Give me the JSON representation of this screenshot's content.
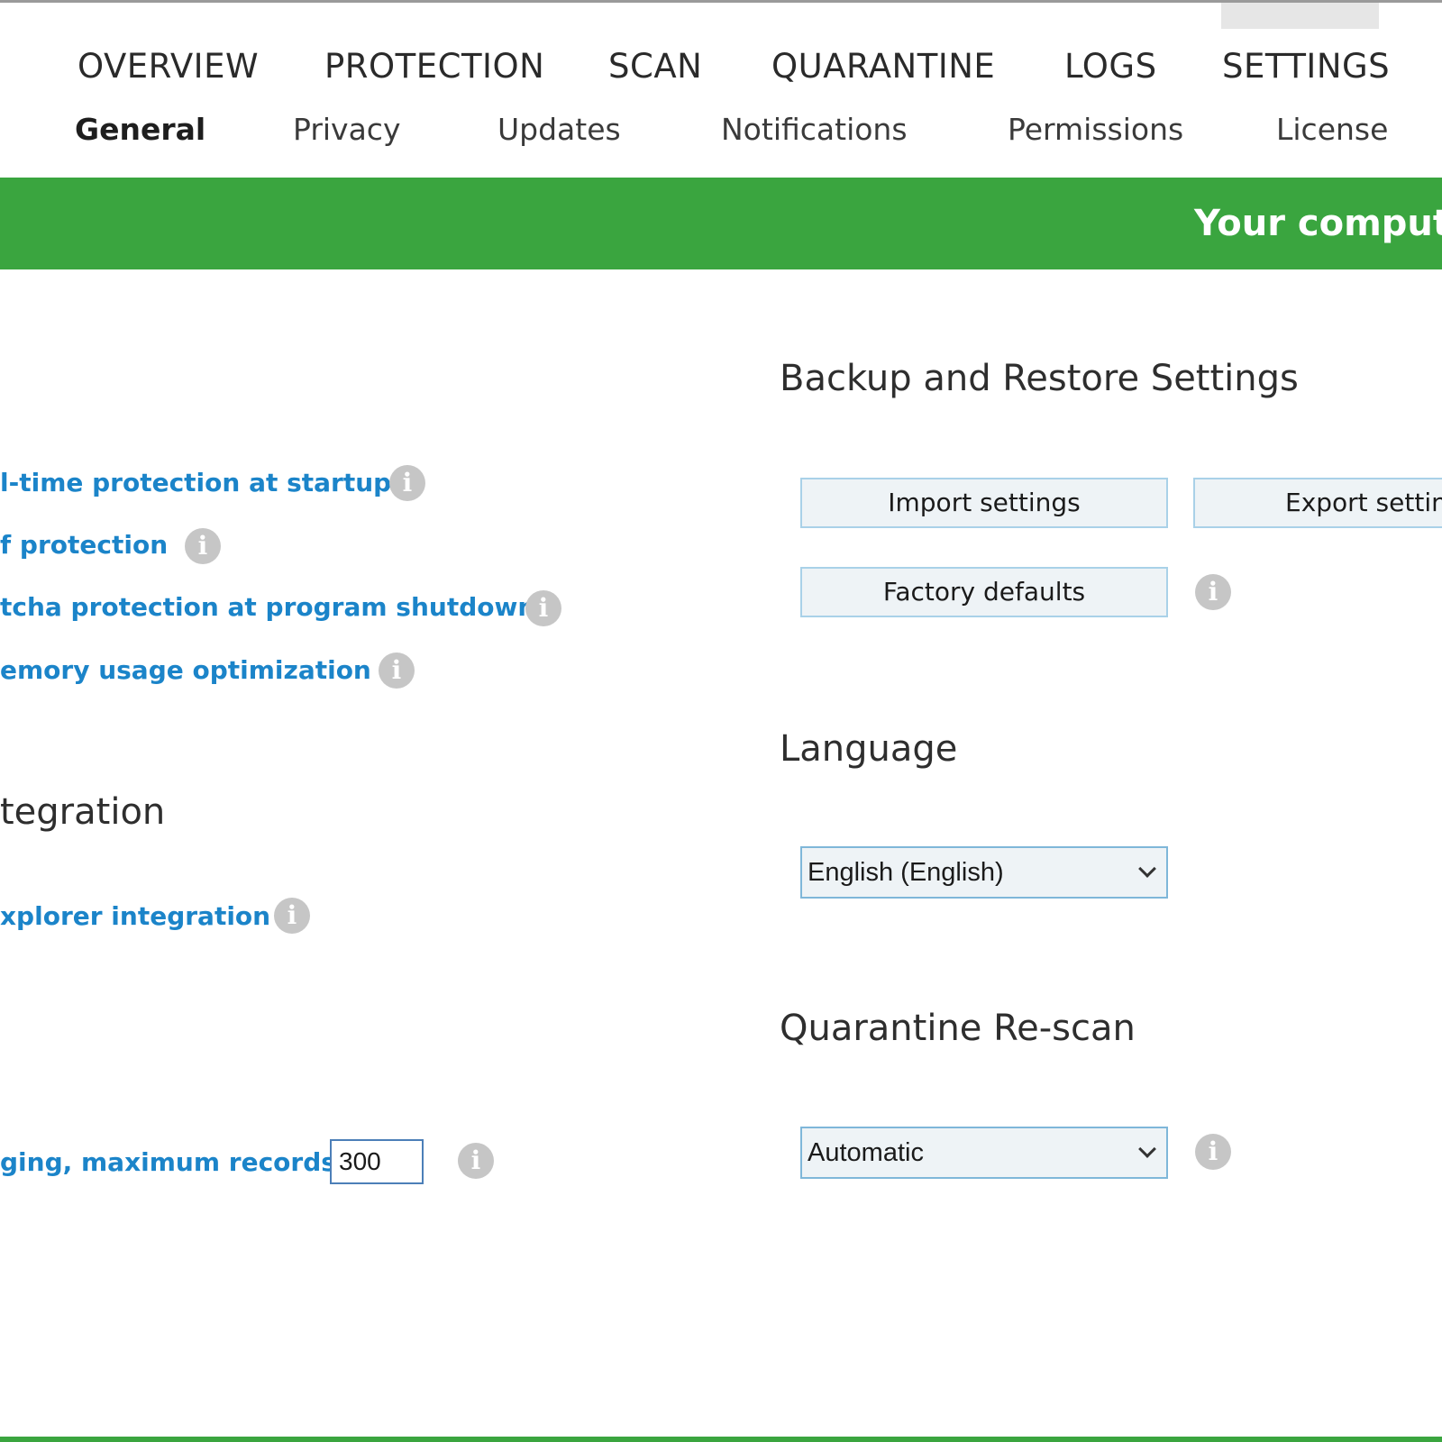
{
  "tabs": {
    "main": [
      {
        "label": "OVERVIEW"
      },
      {
        "label": "PROTECTION"
      },
      {
        "label": "SCAN"
      },
      {
        "label": "QUARANTINE"
      },
      {
        "label": "LOGS"
      },
      {
        "label": "SETTINGS"
      }
    ],
    "active_main": "SETTINGS",
    "sub": [
      {
        "label": "General"
      },
      {
        "label": "Privacy"
      },
      {
        "label": "Updates"
      },
      {
        "label": "Notifications"
      },
      {
        "label": "Permissions"
      },
      {
        "label": "License"
      }
    ],
    "active_sub": "General"
  },
  "status": {
    "text": "Your comput",
    "color": "#3aa53f"
  },
  "left": {
    "options": [
      {
        "label": "l-time protection at startup"
      },
      {
        "label": "f protection"
      },
      {
        "label": "tcha protection at program shutdown"
      },
      {
        "label": "emory usage optimization"
      }
    ],
    "integration_heading": "tegration",
    "integration_option": "xplorer integration",
    "logging": {
      "label": "ging, maximum records:",
      "value": "300"
    }
  },
  "backup": {
    "heading": "Backup and Restore Settings",
    "import_label": "Import settings",
    "export_label": "Export setting",
    "factory_label": "Factory defaults"
  },
  "language": {
    "heading": "Language",
    "selected": "English (English)"
  },
  "rescan": {
    "heading": "Quarantine Re-scan",
    "selected": "Automatic"
  },
  "icons": {
    "info": "i"
  },
  "colors": {
    "accent_green": "#3aa53f",
    "link_blue": "#1b84c9"
  }
}
